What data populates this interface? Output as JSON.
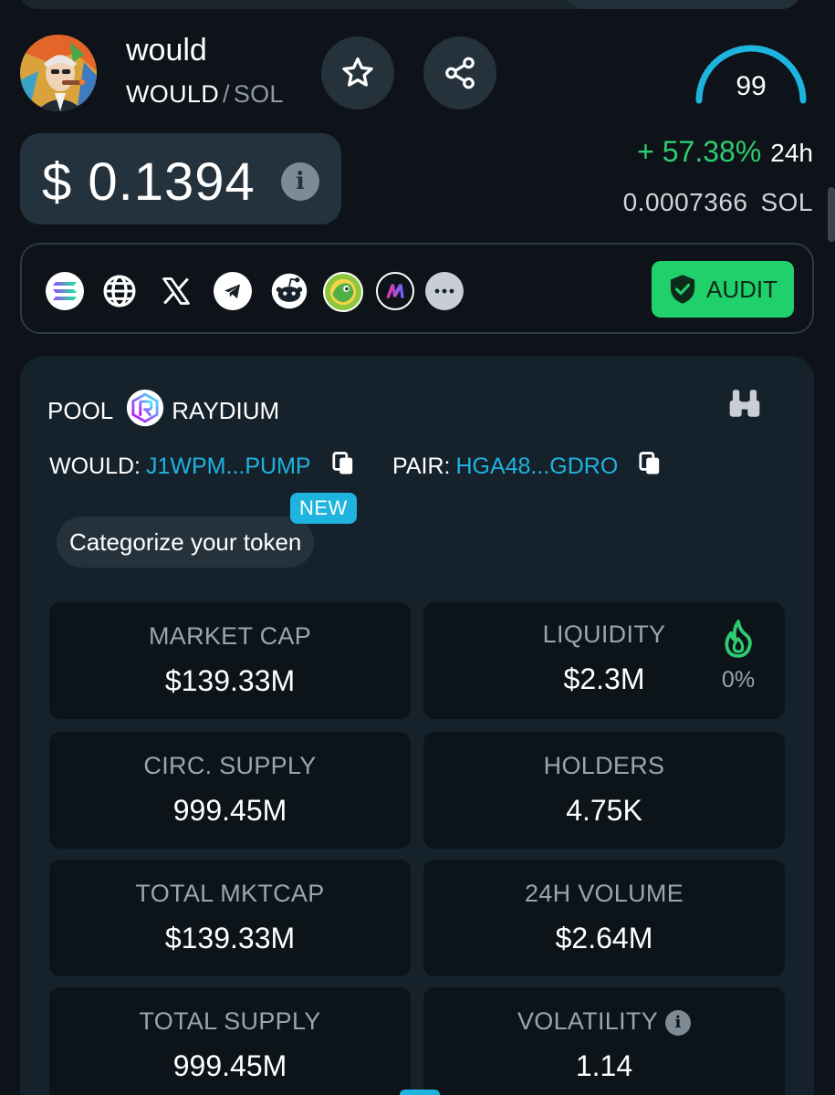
{
  "token": {
    "name": "would",
    "symbol": "WOULD",
    "separator": "/",
    "base": "SOL",
    "score": "99",
    "price": "$ 0.1394",
    "info_glyph": "i",
    "change_pct": "+ 57.38%",
    "change_period": "24h",
    "price_in_sol": "0.0007366",
    "price_in_sol_unit": "SOL"
  },
  "links": {
    "icons": [
      "solana-icon",
      "globe-icon",
      "x-icon",
      "telegram-icon",
      "reddit-icon",
      "coingecko-icon",
      "dextools-icon",
      "more-icon"
    ],
    "audit_label": "AUDIT"
  },
  "pool": {
    "label": "POOL",
    "dex": "RAYDIUM",
    "token_label": "WOULD:",
    "token_address": "J1WPM...PUMP",
    "pair_label": "PAIR:",
    "pair_address": "HGA48...GDRO",
    "new_badge": "NEW",
    "categorize_label": "Categorize your token"
  },
  "stats": {
    "market_cap": {
      "label": "MARKET CAP",
      "value": "$139.33M"
    },
    "liquidity": {
      "label": "LIQUIDITY",
      "value": "$2.3M",
      "burn_pct": "0%"
    },
    "circ_supply": {
      "label": "CIRC. SUPPLY",
      "value": "999.45M"
    },
    "holders": {
      "label": "HOLDERS",
      "value": "4.75K"
    },
    "total_mktcap": {
      "label": "TOTAL MKTCAP",
      "value": "$139.33M"
    },
    "volume_24h": {
      "label": "24H VOLUME",
      "value": "$2.64M"
    },
    "total_supply": {
      "label": "TOTAL SUPPLY",
      "value": "999.45M"
    },
    "volatility": {
      "label": "VOLATILITY",
      "value": "1.14"
    }
  },
  "colors": {
    "background": "#0d1318",
    "card": "#16222b",
    "accent_green": "#2ecc71",
    "audit_green": "#1fd06b",
    "link_blue": "#1fb3e0",
    "gauge_blue": "#1fb3e0"
  }
}
